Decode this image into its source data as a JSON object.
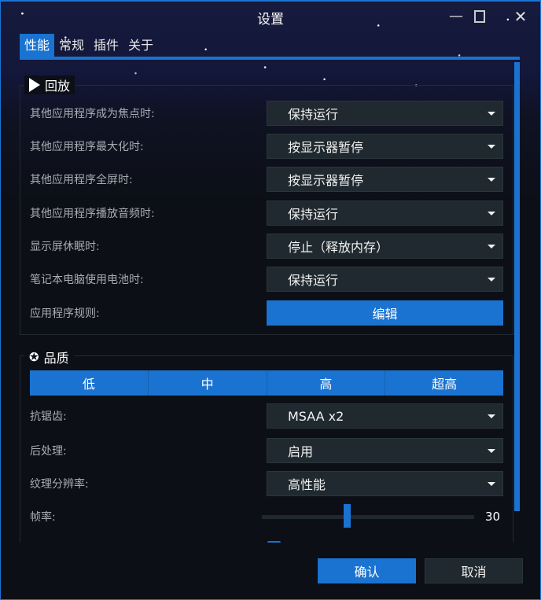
{
  "window": {
    "title": "设置"
  },
  "tabs": [
    {
      "label": "性能",
      "active": true
    },
    {
      "label": "常规"
    },
    {
      "label": "插件"
    },
    {
      "label": "关于"
    }
  ],
  "playback": {
    "title": "回放",
    "icon": "play-icon",
    "rows": [
      {
        "label": "其他应用程序成为焦点时:",
        "value": "保持运行"
      },
      {
        "label": "其他应用程序最大化时:",
        "value": "按显示器暂停"
      },
      {
        "label": "其他应用程序全屏时:",
        "value": "按显示器暂停"
      },
      {
        "label": "其他应用程序播放音频时:",
        "value": "保持运行"
      },
      {
        "label": "显示屏休眠时:",
        "value": "停止（释放内存）"
      },
      {
        "label": "笔记本电脑使用电池时:",
        "value": "保持运行"
      }
    ],
    "rules": {
      "label": "应用程序规则:",
      "button": "编辑"
    }
  },
  "quality": {
    "title": "品质",
    "icon": "award-icon",
    "presets": [
      "低",
      "中",
      "高",
      "超高"
    ],
    "rows": [
      {
        "label": "抗锯齿:",
        "value": "MSAA x2"
      },
      {
        "label": "后处理:",
        "value": "启用"
      },
      {
        "label": "纹理分辨率:",
        "value": "高性能"
      }
    ],
    "framerate": {
      "label": "帧率:",
      "value": "30",
      "fill_fraction": 0.4
    }
  },
  "footer": {
    "ok": "确认",
    "cancel": "取消"
  },
  "colors": {
    "accent": "#1a73d1",
    "dropdown_bg": "#1f292f",
    "background": "#0c0f16"
  }
}
